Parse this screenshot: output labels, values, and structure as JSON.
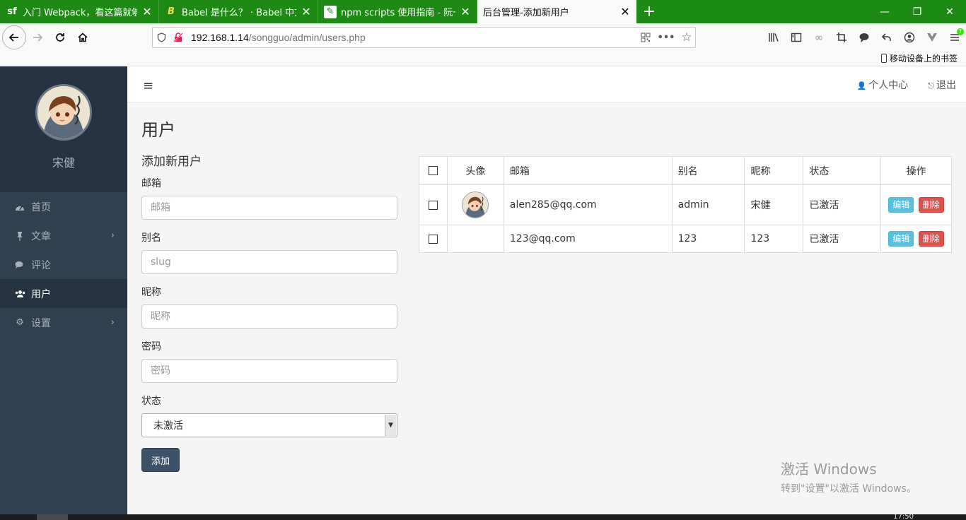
{
  "browser": {
    "tabs": [
      {
        "favicon": "sf",
        "title": "入门 Webpack，看这篇就够了",
        "active": false
      },
      {
        "favicon": "B",
        "title": "Babel 是什么？ · Babel 中文网",
        "active": false
      },
      {
        "favicon": "✎",
        "title": "npm scripts 使用指南 - 阮一峰",
        "active": false
      },
      {
        "favicon": "",
        "title": "后台管理-添加新用户",
        "active": true
      }
    ],
    "new_tab": "+",
    "url_host": "192.168.1.14",
    "url_path": "/songguo/admin/users.php",
    "mobile_bookmarks": "移动设备上的书签",
    "colors": {
      "tabbar": "#1c8a13"
    }
  },
  "sidebar": {
    "user_name": "宋健",
    "menu": [
      {
        "icon": "dashboard-icon",
        "label": "首页",
        "has_children": false,
        "active": false
      },
      {
        "icon": "thumbtack-icon",
        "label": "文章",
        "has_children": true,
        "active": false
      },
      {
        "icon": "comments-icon",
        "label": "评论",
        "has_children": false,
        "active": false
      },
      {
        "icon": "users-icon",
        "label": "用户",
        "has_children": false,
        "active": true
      },
      {
        "icon": "cogs-icon",
        "label": "设置",
        "has_children": true,
        "active": false
      }
    ]
  },
  "topbar": {
    "profile_link": "个人中心",
    "logout_link": "退出"
  },
  "main": {
    "page_title": "用户",
    "form": {
      "title": "添加新用户",
      "email_label": "邮箱",
      "email_placeholder": "邮箱",
      "slug_label": "别名",
      "slug_placeholder": "slug",
      "nickname_label": "昵称",
      "nickname_placeholder": "昵称",
      "password_label": "密码",
      "password_placeholder": "密码",
      "status_label": "状态",
      "status_value": "未激活",
      "submit_label": "添加"
    },
    "table": {
      "headers": {
        "avatar": "头像",
        "email": "邮箱",
        "slug": "别名",
        "nickname": "昵称",
        "status": "状态",
        "actions": "操作"
      },
      "rows": [
        {
          "has_avatar": true,
          "email": "alen285@qq.com",
          "slug": "admin",
          "nickname": "宋健",
          "status": "已激活",
          "edit": "编辑",
          "delete": "删除"
        },
        {
          "has_avatar": false,
          "email": "123@qq.com",
          "slug": "123",
          "nickname": "123",
          "status": "已激活",
          "edit": "编辑",
          "delete": "删除"
        }
      ]
    }
  },
  "watermark": {
    "line1": "激活 Windows",
    "line2": "转到\"设置\"以激活 Windows。"
  },
  "taskbar": {
    "time": "17:50"
  }
}
